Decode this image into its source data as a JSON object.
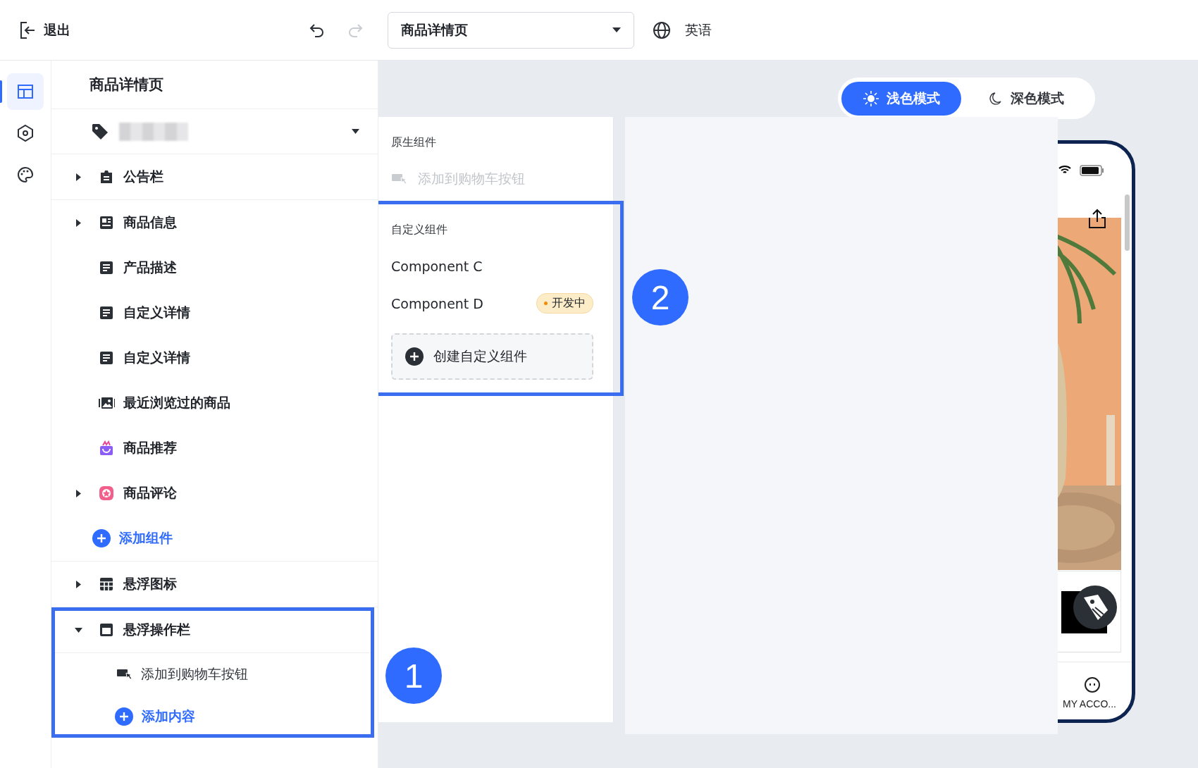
{
  "toolbar": {
    "exit": "退出",
    "undo": {
      "disabled": false
    },
    "redo": {
      "disabled": true
    },
    "page_select": {
      "value": "商品详情页"
    },
    "language": "英语"
  },
  "rail": [
    {
      "selected": true
    },
    {
      "selected": false
    },
    {
      "selected": false
    }
  ],
  "tree": {
    "title": "商品详情页",
    "sections": [
      {
        "rows": [
          {
            "kind": "group",
            "label": "公告栏",
            "expanded": false
          }
        ]
      },
      {
        "rows": [
          {
            "kind": "group",
            "label": "商品信息",
            "expanded": false
          },
          {
            "kind": "item",
            "label": "产品描述"
          },
          {
            "kind": "item",
            "label": "自定义详情"
          },
          {
            "kind": "item",
            "label": "自定义详情"
          },
          {
            "kind": "item",
            "label": "最近浏览过的商品"
          },
          {
            "kind": "item",
            "label": "商品推荐"
          },
          {
            "kind": "group",
            "label": "商品评论",
            "expanded": false
          },
          {
            "kind": "add",
            "label": "添加组件"
          }
        ]
      },
      {
        "rows": [
          {
            "kind": "group",
            "label": "悬浮图标",
            "expanded": false
          }
        ]
      },
      {
        "highlighted": true,
        "rows": [
          {
            "kind": "group",
            "label": "悬浮操作栏",
            "expanded": true,
            "children": [
              {
                "kind": "item",
                "label": "添加到购物车按钮"
              },
              {
                "kind": "add",
                "label": "添加内容"
              }
            ]
          }
        ]
      }
    ]
  },
  "theme_toggle": [
    {
      "label": "浅色模式",
      "selected": true
    },
    {
      "label": "深色模式",
      "selected": false
    }
  ],
  "component_menu": {
    "groups": [
      {
        "title": "原生组件",
        "items": [
          {
            "label": "添加到购物车按钮",
            "disabled": true
          }
        ]
      },
      {
        "title": "自定义组件",
        "highlighted": true,
        "items": [
          {
            "label": "Component C",
            "disabled": false
          },
          {
            "label": "Component D",
            "disabled": false,
            "badge": "开发中"
          }
        ],
        "create": "创建自定义组件"
      }
    ]
  },
  "preview": {
    "bottom_nav": [
      "MY ACCO..."
    ]
  },
  "annotations": [
    {
      "number": "1"
    },
    {
      "number": "2"
    }
  ]
}
